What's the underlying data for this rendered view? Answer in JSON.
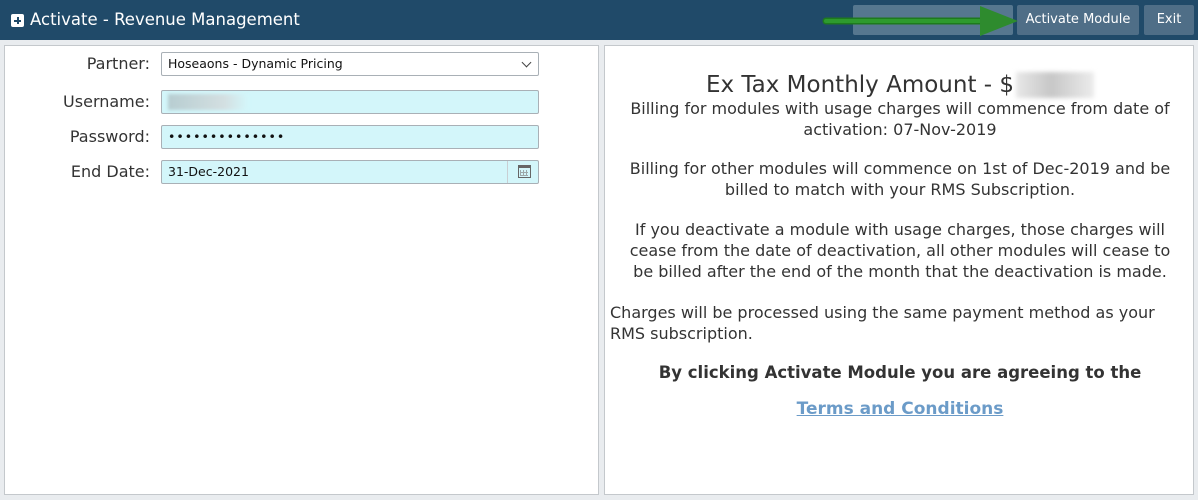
{
  "window": {
    "title": "Activate - Revenue Management"
  },
  "toolbar": {
    "hidden_button_label": "",
    "activate_label": "Activate Module",
    "exit_label": "Exit"
  },
  "form": {
    "partner_label": "Partner:",
    "partner_value": "Hoseaons - Dynamic Pricing",
    "username_label": "Username:",
    "username_value": "",
    "password_label": "Password:",
    "password_value": "••••••••••••••",
    "end_date_label": "End Date:",
    "end_date_value": "31-Dec-2021"
  },
  "billing": {
    "amount_label": "Ex Tax Monthly Amount - $",
    "para1": "Billing for modules with usage charges will commence from date of activation: 07-Nov-2019",
    "para2": "Billing for other modules will commence on 1st of Dec-2019 and be billed to match with your RMS Subscription.",
    "para3": "If you deactivate a module with usage charges, those charges will cease from the date of deactivation, all other modules will cease to be billed after the end of the month that the deactivation is made.",
    "para4": "Charges will be processed using the same payment method as your RMS subscription.",
    "agree_text": "By clicking Activate Module you are agreeing to the",
    "terms_link": "Terms and Conditions"
  },
  "colors": {
    "titlebar": "#204a69",
    "button": "#4f6e87",
    "field_highlight": "#d3f6fa",
    "link": "#6b9bc8",
    "arrow": "#2e8b2e"
  }
}
